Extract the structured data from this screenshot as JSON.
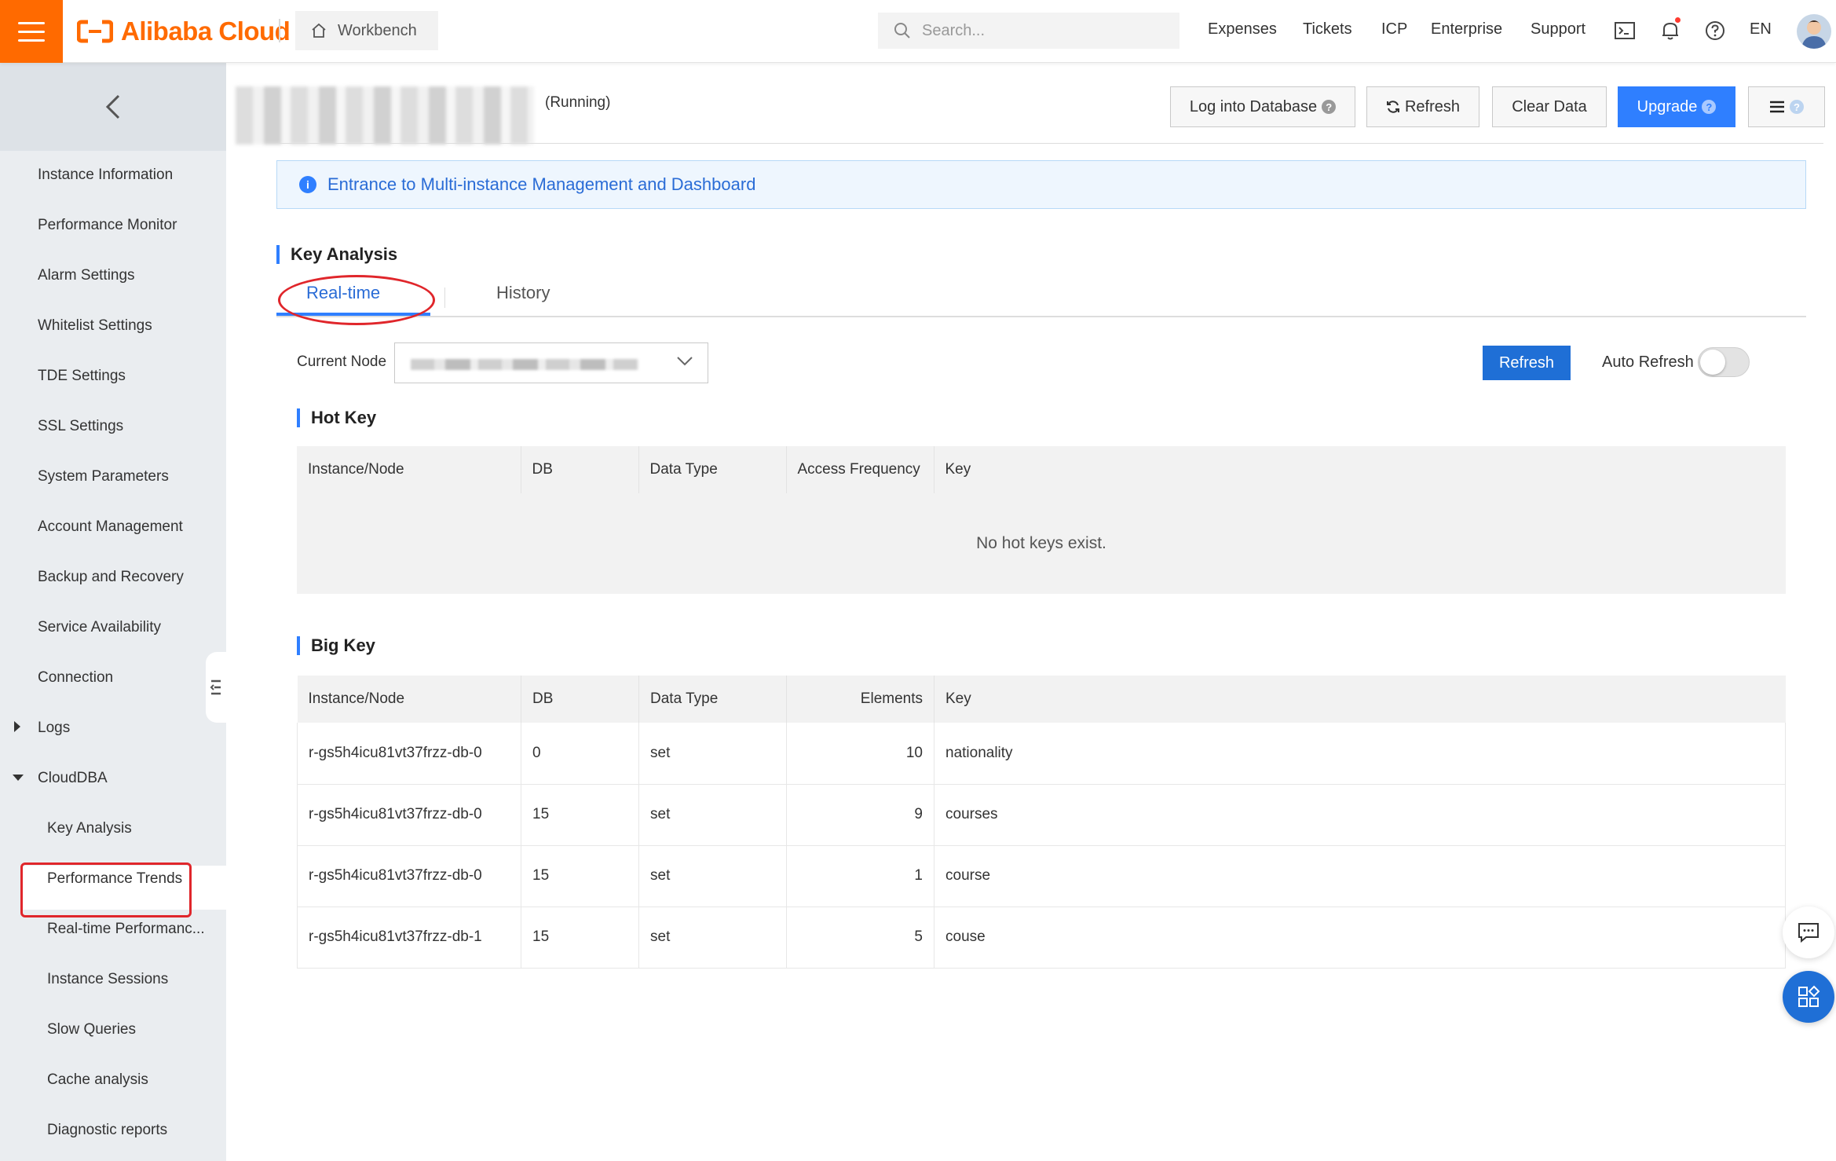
{
  "topbar": {
    "brand": "Alibaba Cloud",
    "workbench": "Workbench",
    "search_placeholder": "Search...",
    "links": [
      "Expenses",
      "Tickets",
      "ICP",
      "Enterprise",
      "Support"
    ],
    "lang": "EN"
  },
  "sidebar": {
    "items": [
      "Instance Information",
      "Performance Monitor",
      "Alarm Settings",
      "Whitelist Settings",
      "TDE Settings",
      "SSL Settings",
      "System Parameters",
      "Account Management",
      "Backup and Recovery",
      "Service Availability",
      "Connection"
    ],
    "logs": "Logs",
    "clouddba": "CloudDBA",
    "sub_items": [
      "Key Analysis",
      "Performance Trends",
      "Real-time Performanc...",
      "Instance Sessions",
      "Slow Queries",
      "Cache analysis",
      "Diagnostic reports"
    ]
  },
  "header": {
    "status": "(Running)",
    "buttons": {
      "log_into_db": "Log into Database",
      "refresh": "Refresh",
      "clear_data": "Clear Data",
      "upgrade": "Upgrade"
    }
  },
  "banner": "Entrance to Multi-instance Management and Dashboard",
  "key_analysis": {
    "title": "Key Analysis",
    "tabs": [
      "Real-time",
      "History"
    ],
    "current_node_label": "Current Node",
    "refresh": "Refresh",
    "auto_refresh": "Auto Refresh",
    "auto_refresh_on": false
  },
  "hot_key": {
    "title": "Hot Key",
    "columns": [
      "Instance/Node",
      "DB",
      "Data Type",
      "Access Frequency",
      "Key"
    ],
    "empty": "No hot keys exist."
  },
  "big_key": {
    "title": "Big Key",
    "columns": [
      "Instance/Node",
      "DB",
      "Data Type",
      "Elements",
      "Key"
    ],
    "rows": [
      [
        "r-gs5h4icu81vt37frzz-db-0",
        "0",
        "set",
        "10",
        "nationality"
      ],
      [
        "r-gs5h4icu81vt37frzz-db-0",
        "15",
        "set",
        "9",
        "courses"
      ],
      [
        "r-gs5h4icu81vt37frzz-db-0",
        "15",
        "set",
        "1",
        "course"
      ],
      [
        "r-gs5h4icu81vt37frzz-db-1",
        "15",
        "set",
        "5",
        "couse"
      ]
    ]
  },
  "colors": {
    "brand_orange": "#ff6a00",
    "primary_blue": "#2f7fff",
    "annotation_red": "#e0262b"
  }
}
